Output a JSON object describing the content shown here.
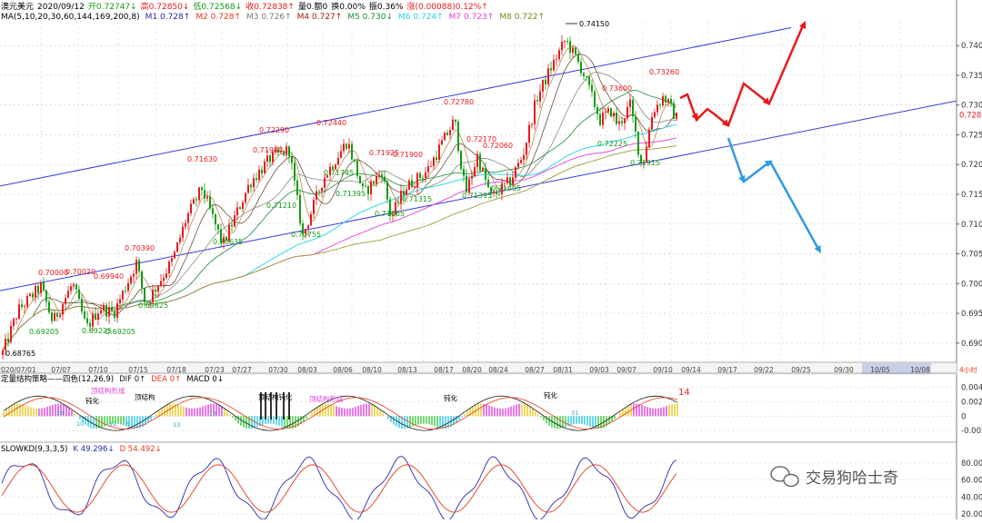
{
  "colors": {
    "up": "#e8191b",
    "down": "#119b11",
    "ma1": "#5a3a1a",
    "ma2": "#1a8a3a",
    "ma3": "#21d5e8",
    "ma4": "#e53ce0",
    "ma5": "#9c9c3a",
    "channel": "#3a3ad8",
    "arrow_red": "#e8191b",
    "arrow_blue": "#2b9be8",
    "grid": "#c8c8c8",
    "k_line": "#2a2ab0",
    "d_line": "#e8391b",
    "dif_line": "#1a1a1a",
    "dea_line": "#e8391b"
  },
  "header": {
    "line1": [
      {
        "text": "澳元美元",
        "color": "#000000"
      },
      {
        "text": "2020/09/12",
        "color": "#000000"
      },
      {
        "text": "开0.72747↓",
        "color": "#119b11"
      },
      {
        "text": "高0.72850↓",
        "color": "#e8191b"
      },
      {
        "text": "低0.72568↓",
        "color": "#119b11"
      },
      {
        "text": "收0.72838↑",
        "color": "#e8191b"
      },
      {
        "text": "量0.额0",
        "color": "#000000"
      },
      {
        "text": "换0.00%",
        "color": "#000000"
      },
      {
        "text": "振0.36%",
        "color": "#000000"
      },
      {
        "text": "涨(0.00088)0.12%↑",
        "color": "#e8191b"
      }
    ],
    "line2": [
      {
        "text": "MA(5,10,20,30,60,144,169,200,8)",
        "color": "#000000"
      },
      {
        "text": "M1 0.728↑",
        "color": "#2a2ab0"
      },
      {
        "text": "M2 0.728↑",
        "color": "#e8391b"
      },
      {
        "text": "M3 0.726↑",
        "color": "#7a7a7a"
      },
      {
        "text": "M4 0.727↑",
        "color": "#a01818"
      },
      {
        "text": "M5 0.730↓",
        "color": "#1a8a3a"
      },
      {
        "text": "M6 0.724↑",
        "color": "#21d5e8"
      },
      {
        "text": "M7 0.723↑",
        "color": "#e53ce0"
      },
      {
        "text": "M8 0.722↑",
        "color": "#6a8a1a"
      }
    ]
  },
  "chart_data": [
    {
      "type": "candlestick",
      "title": "澳元美元",
      "ylim": [
        0.686,
        0.744
      ],
      "y_ticks": [
        "0.7400",
        "0.7350",
        "0.7300",
        "0.7250",
        "0.7200",
        "0.7150",
        "0.7100",
        "0.7050",
        "0.7000",
        "0.6950",
        "0.6900"
      ],
      "x_ticks": [
        "2020/07/01",
        "07/07",
        "07/10",
        "07/15",
        "07/18",
        "07/23",
        "07/27",
        "07/30",
        "08/03",
        "08/06",
        "08/10",
        "08/13",
        "08/17",
        "08/20",
        "08/24",
        "08/27",
        "08/31",
        "09/03",
        "09/07",
        "09/10",
        "09/14",
        "09/17",
        "09/22",
        "09/25",
        "09/30",
        "10/05",
        "10/08"
      ],
      "last_price": "0.72838",
      "period_label": "4小时",
      "annotations": [
        {
          "text": "0.68765",
          "value": 0.68765,
          "color": "#000000"
        },
        {
          "text": "0.70000",
          "value": 0.7,
          "color": "#e8191b"
        },
        {
          "text": "0.70020",
          "value": 0.7002,
          "color": "#e8191b"
        },
        {
          "text": "0.69940",
          "value": 0.6994,
          "color": "#e8191b"
        },
        {
          "text": "0.69205",
          "value": 0.69205,
          "color": "#119b11"
        },
        {
          "text": "0.69225",
          "value": 0.69225,
          "color": "#119b11"
        },
        {
          "text": "0.69205",
          "value": 0.69205,
          "color": "#119b11"
        },
        {
          "text": "0.70390",
          "value": 0.7039,
          "color": "#e8191b"
        },
        {
          "text": "0.69625",
          "value": 0.69625,
          "color": "#119b11"
        },
        {
          "text": "0.71630",
          "value": 0.7163,
          "color": "#e8191b"
        },
        {
          "text": "0.70635",
          "value": 0.70635,
          "color": "#119b11"
        },
        {
          "text": "0.72290",
          "value": 0.7229,
          "color": "#e8191b"
        },
        {
          "text": "0.71980",
          "value": 0.7198,
          "color": "#e8191b"
        },
        {
          "text": "0.71210",
          "value": 0.7121,
          "color": "#119b11"
        },
        {
          "text": "0.70755",
          "value": 0.70755,
          "color": "#119b11"
        },
        {
          "text": "0.72440",
          "value": 0.7244,
          "color": "#e8191b"
        },
        {
          "text": "0.71745",
          "value": 0.71745,
          "color": "#119b11"
        },
        {
          "text": "0.71395",
          "value": 0.71395,
          "color": "#119b11"
        },
        {
          "text": "0.71925",
          "value": 0.71925,
          "color": "#e8191b"
        },
        {
          "text": "0.71900",
          "value": 0.719,
          "color": "#e8191b"
        },
        {
          "text": "0.71065",
          "value": 0.71065,
          "color": "#119b11"
        },
        {
          "text": "0.71315",
          "value": 0.71315,
          "color": "#119b11"
        },
        {
          "text": "0.72780",
          "value": 0.7278,
          "color": "#e8191b"
        },
        {
          "text": "0.72170",
          "value": 0.7217,
          "color": "#e8191b"
        },
        {
          "text": "0.72060",
          "value": 0.7206,
          "color": "#e8191b"
        },
        {
          "text": "0.71495",
          "value": 0.71495,
          "color": "#119b11"
        },
        {
          "text": "0.71395",
          "value": 0.71395,
          "color": "#119b11"
        },
        {
          "text": "0.74150",
          "value": 0.7415,
          "color": "#000000"
        },
        {
          "text": "0.73600",
          "value": 0.736,
          "color": "#e8191b"
        },
        {
          "text": "0.73260",
          "value": 0.7326,
          "color": "#e8191b"
        },
        {
          "text": "0.72225",
          "value": 0.72225,
          "color": "#119b11"
        },
        {
          "text": "0.71915",
          "value": 0.71915,
          "color": "#119b11"
        }
      ]
    },
    {
      "type": "line",
      "title": "定量结构策略——四色(12,26,9)",
      "series": [
        {
          "name": "DIF 0↑",
          "color": "#1a1a1a"
        },
        {
          "name": "DEA 0↑",
          "color": "#e8391b"
        },
        {
          "name": "MACD 0↓",
          "color": "#000000"
        }
      ],
      "y_ticks": [
        "0.004",
        "0.002",
        "0",
        "-0.002"
      ],
      "labels": [
        "顶结构形成",
        "顶结构",
        "钝化",
        "顶结构钝化",
        "顶结构形成",
        "钝化",
        "钝化"
      ],
      "count_label": "14",
      "hist_numbers": [
        "10",
        "12",
        "6",
        "13",
        "17",
        "28",
        "31"
      ]
    },
    {
      "type": "line",
      "title": "SLOWKD(9,3,3,5)",
      "series": [
        {
          "name": "K 49.296↓",
          "color": "#2a2ab0"
        },
        {
          "name": "D 54.492↓",
          "color": "#e8391b"
        }
      ],
      "y_ticks": [
        "80.00",
        "60.00",
        "40.00",
        "20.00"
      ]
    }
  ],
  "watermark": {
    "text": "交易狗哈士奇"
  }
}
